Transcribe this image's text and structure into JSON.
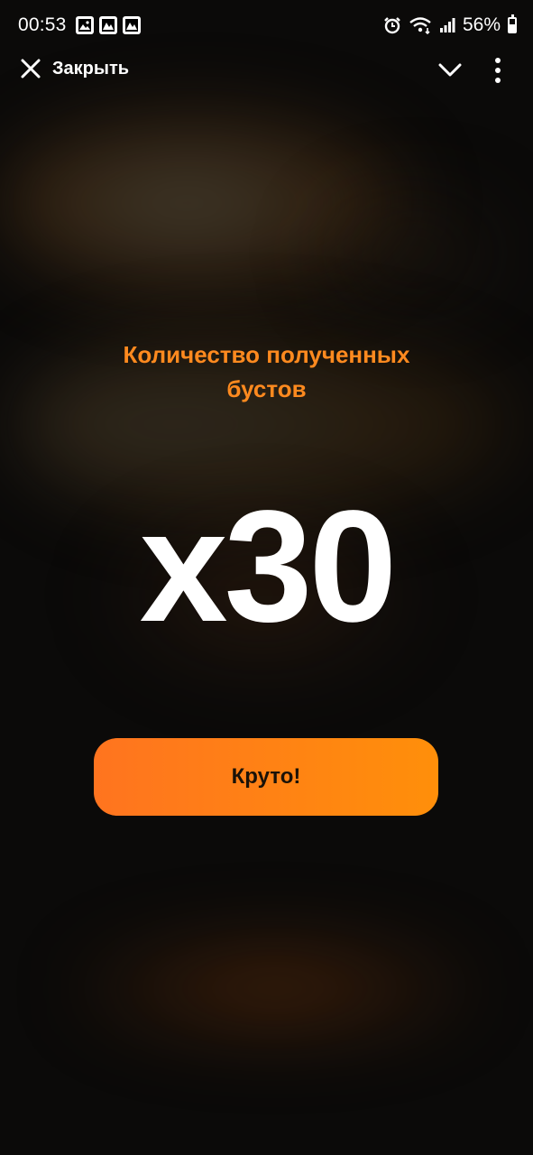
{
  "status_bar": {
    "time": "00:53",
    "battery": "56%"
  },
  "app_bar": {
    "close_label": "Закрыть"
  },
  "content": {
    "title": "Количество полученных бустов",
    "counter": "x30",
    "button_label": "Круто!"
  },
  "colors": {
    "accent": "#ff8a1f",
    "button_start": "#ff741f",
    "button_end": "#ff8f0a",
    "background": "#0b0a09"
  },
  "icons": [
    "close-icon",
    "chevron-down-icon",
    "more-vertical-icon",
    "gallery-notification-icon",
    "alarm-icon",
    "wifi-icon",
    "signal-icon",
    "battery-icon"
  ]
}
